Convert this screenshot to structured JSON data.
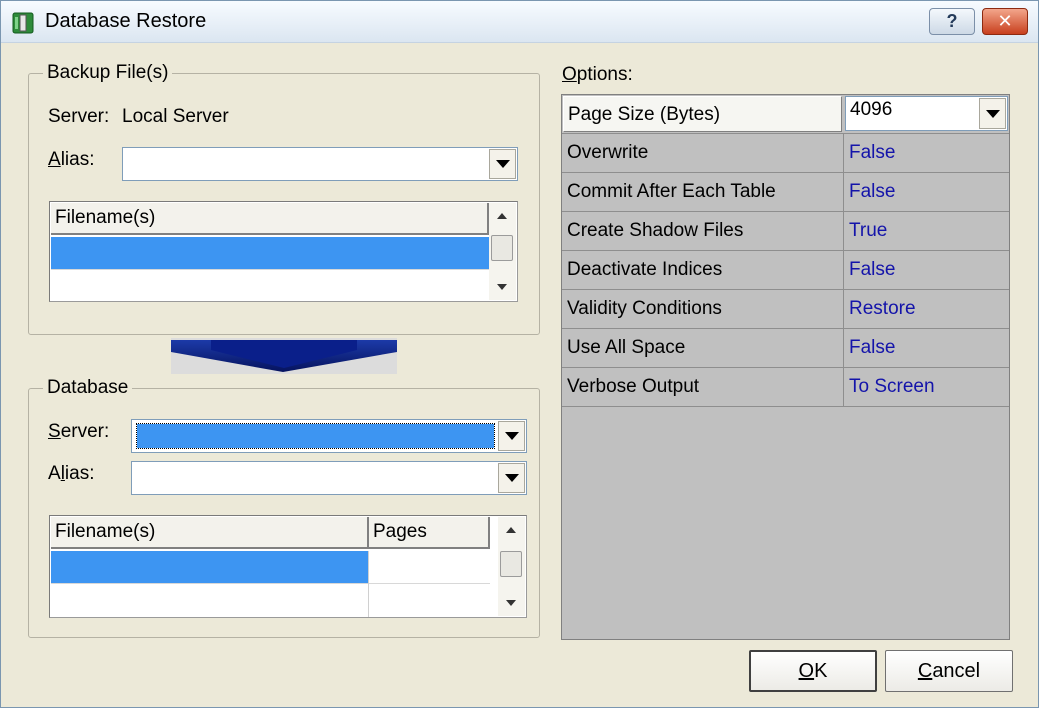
{
  "window": {
    "title": "Database Restore",
    "help_glyph": "?",
    "close_glyph": "✕"
  },
  "backup": {
    "legend": "Backup File(s)",
    "server_label": "Server:",
    "server_value": "Local Server",
    "alias_label_prefix": "A",
    "alias_label_rest": "lias:",
    "alias_value": "",
    "list_header": "Filename(s)"
  },
  "database": {
    "legend": "Database",
    "server_label_prefix": "S",
    "server_label_rest": "erver:",
    "server_value": "",
    "alias_label_first": "A",
    "alias_label_u": "l",
    "alias_label_rest": "ias:",
    "alias_value": "",
    "col_filename": "Filename(s)",
    "col_pages": "Pages"
  },
  "options": {
    "label_prefix": "O",
    "label_rest": "ptions:",
    "page_size": {
      "name": "Page Size (Bytes)",
      "value": "4096"
    },
    "rows": [
      {
        "name": "Overwrite",
        "value": "False"
      },
      {
        "name": "Commit After Each Table",
        "value": "False"
      },
      {
        "name": "Create Shadow Files",
        "value": "True"
      },
      {
        "name": "Deactivate Indices",
        "value": "False"
      },
      {
        "name": "Validity Conditions",
        "value": "Restore"
      },
      {
        "name": "Use All Space",
        "value": "False"
      },
      {
        "name": "Verbose Output",
        "value": "To Screen"
      }
    ]
  },
  "buttons": {
    "ok_prefix": "O",
    "ok_rest": "K",
    "cancel_prefix": "C",
    "cancel_rest": "ancel"
  },
  "colors": {
    "selection": "#3d95f2",
    "option_value": "#1414aa",
    "arrow": "#0a1f8a"
  }
}
